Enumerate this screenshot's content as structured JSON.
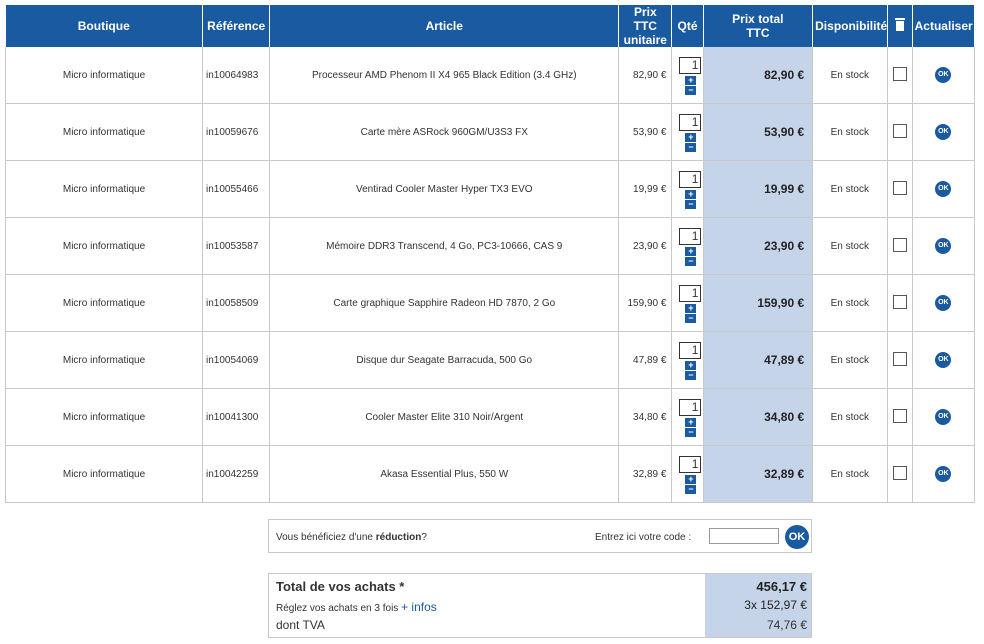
{
  "headers": {
    "boutique": "Boutique",
    "reference": "Référence",
    "article": "Article",
    "prix_unitaire_l1": "Prix TTC",
    "prix_unitaire_l2": "unitaire",
    "qte": "Qté",
    "prix_total_l1": "Prix total",
    "prix_total_l2": "TTC",
    "disponibilite": "Disponibilité",
    "actualiser": "Actualiser"
  },
  "rows": [
    {
      "boutique": "Micro informatique",
      "ref": "in10064983",
      "article": "Processeur AMD Phenom II X4 965 Black Edition (3.4 GHz)",
      "unit": "82,90 €",
      "qty": "1",
      "total": "82,90 €",
      "dispo": "En stock",
      "plus": "+",
      "minus": "−",
      "ok": "OK"
    },
    {
      "boutique": "Micro informatique",
      "ref": "in10059676",
      "article": "Carte mère ASRock 960GM/U3S3 FX",
      "unit": "53,90 €",
      "qty": "1",
      "total": "53,90 €",
      "dispo": "En stock",
      "plus": "+",
      "minus": "−",
      "ok": "OK"
    },
    {
      "boutique": "Micro informatique",
      "ref": "in10055466",
      "article": "Ventirad Cooler Master Hyper TX3 EVO",
      "unit": "19,99 €",
      "qty": "1",
      "total": "19,99 €",
      "dispo": "En stock",
      "plus": "+",
      "minus": "−",
      "ok": "OK"
    },
    {
      "boutique": "Micro informatique",
      "ref": "in10053587",
      "article": "Mémoire DDR3 Transcend, 4 Go, PC3-10666, CAS 9",
      "unit": "23,90 €",
      "qty": "1",
      "total": "23,90 €",
      "dispo": "En stock",
      "plus": "+",
      "minus": "−",
      "ok": "OK"
    },
    {
      "boutique": "Micro informatique",
      "ref": "in10058509",
      "article": "Carte graphique Sapphire Radeon HD 7870, 2 Go",
      "unit": "159,90 €",
      "qty": "1",
      "total": "159,90 €",
      "dispo": "En stock",
      "plus": "+",
      "minus": "−",
      "ok": "OK"
    },
    {
      "boutique": "Micro informatique",
      "ref": "in10054069",
      "article": "Disque dur Seagate Barracuda, 500 Go",
      "unit": "47,89 €",
      "qty": "1",
      "total": "47,89 €",
      "dispo": "En stock",
      "plus": "+",
      "minus": "−",
      "ok": "OK"
    },
    {
      "boutique": "Micro informatique",
      "ref": "in10041300",
      "article": "Cooler Master Elite 310 Noir/Argent",
      "unit": "34,80 €",
      "qty": "1",
      "total": "34,80 €",
      "dispo": "En stock",
      "plus": "+",
      "minus": "−",
      "ok": "OK"
    },
    {
      "boutique": "Micro informatique",
      "ref": "in10042259",
      "article": "Akasa Essential Plus, 550 W",
      "unit": "32,89 €",
      "qty": "1",
      "total": "32,89 €",
      "dispo": "En stock",
      "plus": "+",
      "minus": "−",
      "ok": "OK"
    }
  ],
  "promo": {
    "text_before": "Vous bénéficiez d'une ",
    "text_bold": "réduction",
    "text_after": "?",
    "code_label": "Entrez ici votre code :",
    "code_value": "",
    "ok_label": "OK"
  },
  "totals": {
    "label": "Total de vos achats *",
    "value": "456,17 €",
    "installments_text": "Réglez vos achats en 3 fois",
    "infos_link": "+ infos",
    "installments_value": "3x  152,97 €",
    "tva_label": "dont TVA",
    "tva_value": "74,76 €"
  },
  "colors": {
    "header_bg": "#1a5aa0",
    "total_column_bg": "#c6d4ea"
  },
  "icons": {
    "delete_header": "trash-icon",
    "refresh_button": "ok-icon"
  }
}
